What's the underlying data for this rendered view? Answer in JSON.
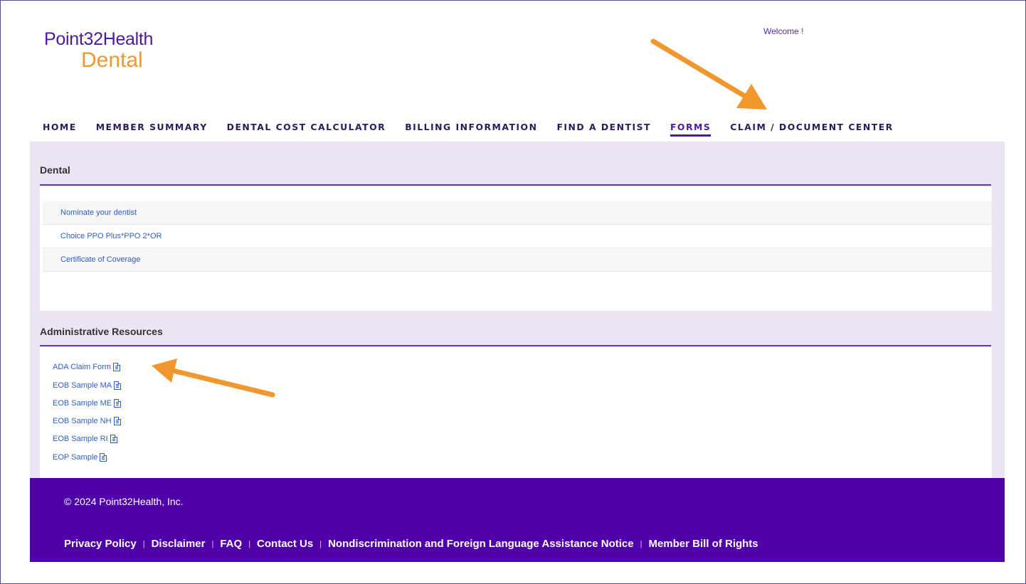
{
  "brand": {
    "name_top": "Point32Health",
    "name_bottom": "Dental",
    "primary_color": "#4b1aa0",
    "accent_color": "#f2962e"
  },
  "header": {
    "welcome": "Welcome !"
  },
  "nav": {
    "items": [
      {
        "label": "HOME"
      },
      {
        "label": "MEMBER SUMMARY"
      },
      {
        "label": "DENTAL COST CALCULATOR"
      },
      {
        "label": "BILLING INFORMATION"
      },
      {
        "label": "FIND A DENTIST"
      },
      {
        "label": "FORMS",
        "active": true
      },
      {
        "label": "CLAIM / DOCUMENT CENTER"
      }
    ]
  },
  "dental": {
    "title": "Dental",
    "items": [
      {
        "label": "Nominate your dentist"
      },
      {
        "label": "Choice PPO Plus*PPO 2*OR"
      },
      {
        "label": "Certificate of Coverage"
      }
    ]
  },
  "admin": {
    "title": "Administrative Resources",
    "items": [
      {
        "label": "ADA Claim Form",
        "icon": "pdf-icon"
      },
      {
        "label": "EOB Sample MA",
        "icon": "pdf-icon"
      },
      {
        "label": "EOB Sample ME",
        "icon": "pdf-icon"
      },
      {
        "label": "EOB Sample NH",
        "icon": "pdf-icon"
      },
      {
        "label": "EOB Sample RI",
        "icon": "pdf-icon"
      },
      {
        "label": "EOP Sample",
        "icon": "pdf-icon"
      }
    ]
  },
  "footer": {
    "copyright": "© 2024 Point32Health, Inc.",
    "links": [
      {
        "label": "Privacy Policy"
      },
      {
        "label": "Disclaimer"
      },
      {
        "label": "FAQ"
      },
      {
        "label": "Contact Us"
      },
      {
        "label": "Nondiscrimination and Foreign Language Assistance Notice"
      },
      {
        "label": "Member Bill of Rights"
      }
    ],
    "separator": "|",
    "background_color": "#5000a8"
  },
  "annotations": {
    "arrow_color": "#f2962e"
  }
}
